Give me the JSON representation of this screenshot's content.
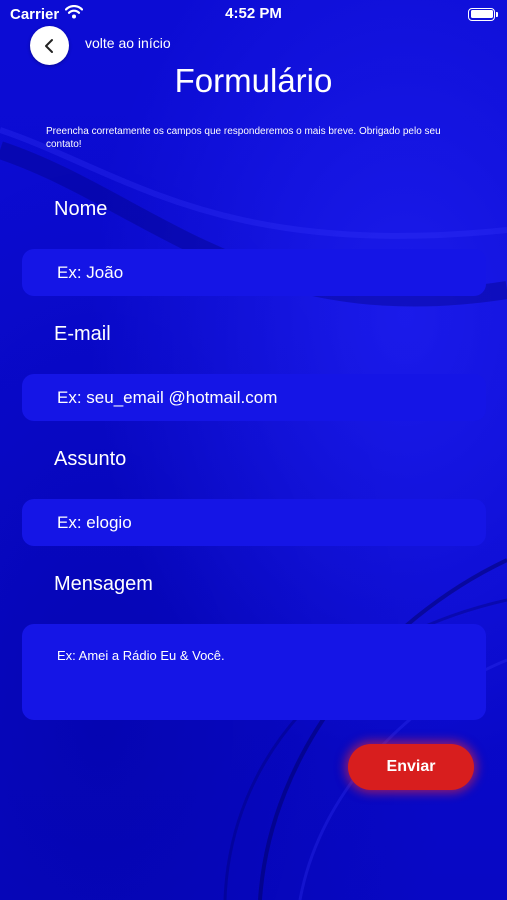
{
  "colors": {
    "background": "#0a0ad0",
    "field_background": "#1515e6",
    "send_button": "#d81e1e",
    "text": "#ffffff"
  },
  "status_bar": {
    "carrier": "Carrier",
    "time": "4:52 PM",
    "wifi_icon": "wifi-icon",
    "battery_icon": "battery-icon"
  },
  "header": {
    "back_icon": "chevron-left-icon",
    "back_label": "volte ao início",
    "title": "Formulário"
  },
  "intro": "Preencha corretamente os campos que responderemos o mais breve. Obrigado pelo seu contato!",
  "form": {
    "name": {
      "label": "Nome",
      "placeholder": "Ex: João"
    },
    "email": {
      "label": "E-mail",
      "placeholder": "Ex: seu_email @hotmail.com"
    },
    "subject": {
      "label": "Assunto",
      "placeholder": "Ex: elogio"
    },
    "message": {
      "label": "Mensagem",
      "placeholder": "Ex: Amei a Rádio Eu & Você."
    },
    "submit_label": "Enviar"
  }
}
